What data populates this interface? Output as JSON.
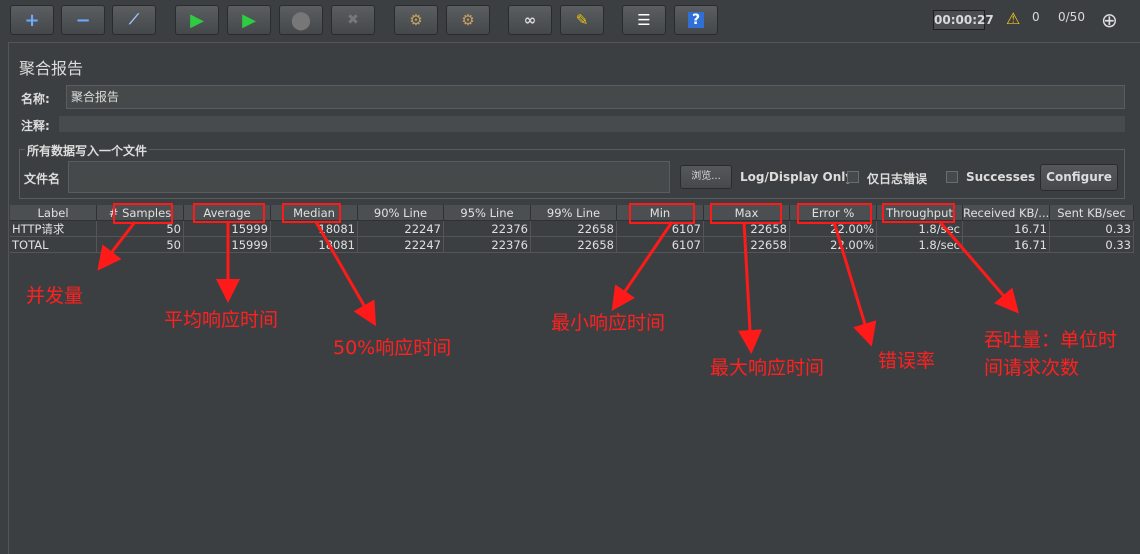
{
  "toolbar": {
    "buttons": [
      {
        "name": "add-button",
        "icon": "plus-icon",
        "glyph": "+"
      },
      {
        "name": "remove-button",
        "icon": "minus-icon",
        "glyph": "−"
      },
      {
        "name": "toggle-button",
        "icon": "wand-icon",
        "glyph": "⚡"
      },
      {
        "name": "start-button",
        "icon": "play-icon",
        "glyph": "▶"
      },
      {
        "name": "start-no-pause-button",
        "icon": "play-timer-icon",
        "glyph": "▶"
      },
      {
        "name": "stop-button",
        "icon": "stop-icon",
        "glyph": "●"
      },
      {
        "name": "shutdown-button",
        "icon": "shutdown-icon",
        "glyph": "✖"
      },
      {
        "name": "clear-button",
        "icon": "broom-gear-icon",
        "glyph": "✎"
      },
      {
        "name": "clear-all-button",
        "icon": "broom-gear-all-icon",
        "glyph": "✎"
      },
      {
        "name": "search-button",
        "icon": "binoculars-icon",
        "glyph": "⚇"
      },
      {
        "name": "reset-search-button",
        "icon": "broom-icon",
        "glyph": "✂"
      },
      {
        "name": "function-helper-button",
        "icon": "list-icon",
        "glyph": "☰"
      },
      {
        "name": "help-button",
        "icon": "help-icon",
        "glyph": "?"
      }
    ],
    "timer": "00:00:27",
    "warnings": "0",
    "threads": "0/50"
  },
  "panel": {
    "title": "聚合报告",
    "name_label": "名称:",
    "name_value": "聚合报告",
    "comment_label": "注释:",
    "comment_value": "",
    "group_title": "所有数据写入一个文件",
    "filename_label": "文件名",
    "filename_value": "",
    "browse_label": "浏览...",
    "log_display_label": "Log/Display Only:",
    "errors_only_label": "仅日志错误",
    "successes_label": "Successes",
    "configure_label": "Configure"
  },
  "table": {
    "columns": [
      "Label",
      "# Samples",
      "Average",
      "Median",
      "90% Line",
      "95% Line",
      "99% Line",
      "Min",
      "Max",
      "Error %",
      "Throughput",
      "Received KB/...",
      "Sent KB/sec"
    ],
    "rows": [
      [
        "HTTP请求",
        "50",
        "15999",
        "18081",
        "22247",
        "22376",
        "22658",
        "6107",
        "22658",
        "22.00%",
        "1.8/sec",
        "16.71",
        "0.33"
      ],
      [
        "TOTAL",
        "50",
        "15999",
        "18081",
        "22247",
        "22376",
        "22658",
        "6107",
        "22658",
        "22.00%",
        "1.8/sec",
        "16.71",
        "0.33"
      ]
    ]
  },
  "annotations": {
    "samples": "并发量",
    "average": "平均响应时间",
    "median": "50%响应时间",
    "min": "最小响应时间",
    "max": "最大响应时间",
    "error": "错误率",
    "throughput_line1": "吞吐量：单位时",
    "throughput_line2": "间请求次数",
    "color": "#ff1a1a"
  }
}
